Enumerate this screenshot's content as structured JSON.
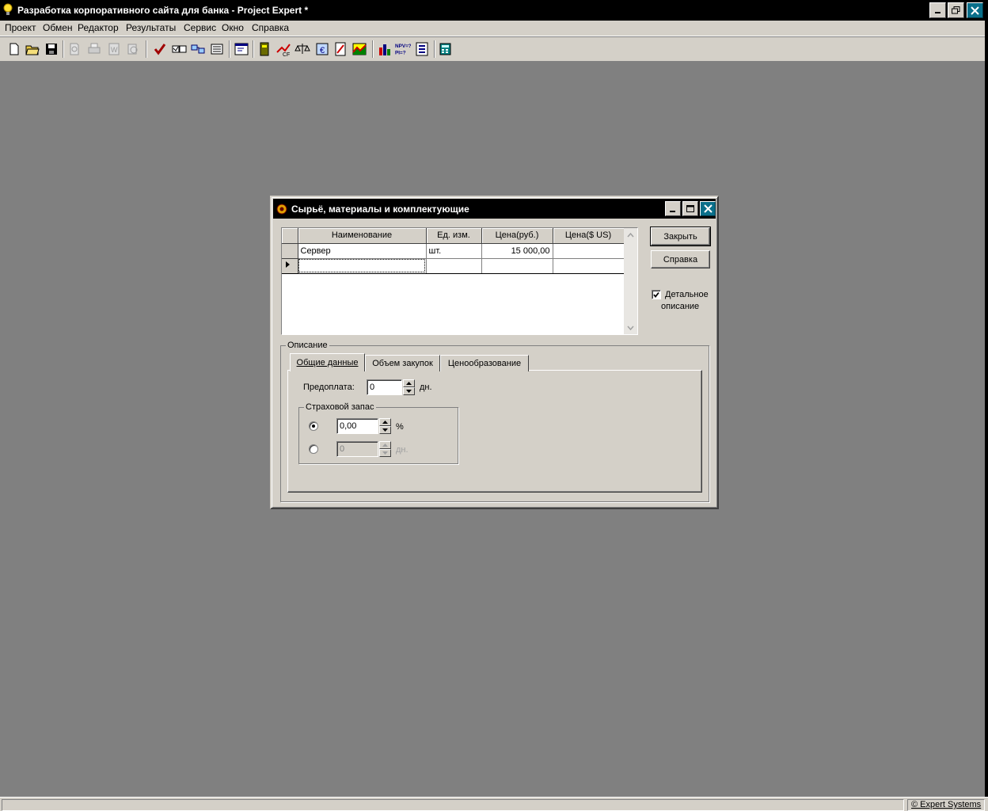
{
  "app": {
    "title": "Разработка корпоративного сайта для банка - Project Expert *",
    "menu": [
      "Проект",
      "Обмен",
      "Редактор",
      "Результаты",
      "Сервис",
      "Окно",
      "Справка"
    ],
    "status_right": "© Expert Systems"
  },
  "dialog": {
    "title": "Сырьё, материалы и комплектующие",
    "grid": {
      "columns": [
        "Наименование",
        "Ед. изм.",
        "Цена(руб.)",
        "Цена($ US)"
      ],
      "rows": [
        [
          "Сервер",
          "шт.",
          "15 000,00",
          ""
        ],
        [
          "",
          "",
          "",
          ""
        ]
      ]
    },
    "buttons": {
      "close": "Закрыть",
      "help": "Справка"
    },
    "detail_checkbox": {
      "label_line1": "Детальное",
      "label_line2": "описание",
      "checked": true
    },
    "description_group": "Описание",
    "tabs": [
      "Общие данные",
      "Объем закупок",
      "Ценообразование"
    ],
    "active_tab": 0,
    "prepay": {
      "label": "Предоплата:",
      "value": "0",
      "unit": "дн."
    },
    "safety_stock": {
      "caption": "Страховой запас",
      "percent_value": "0,00",
      "percent_unit": "%",
      "days_value": "0",
      "days_unit": "дн."
    }
  },
  "colors": {
    "title_bar": "#000000",
    "desktop": "#808080",
    "face": "#d4d0c8",
    "close_btn": "#0a6f8a"
  }
}
